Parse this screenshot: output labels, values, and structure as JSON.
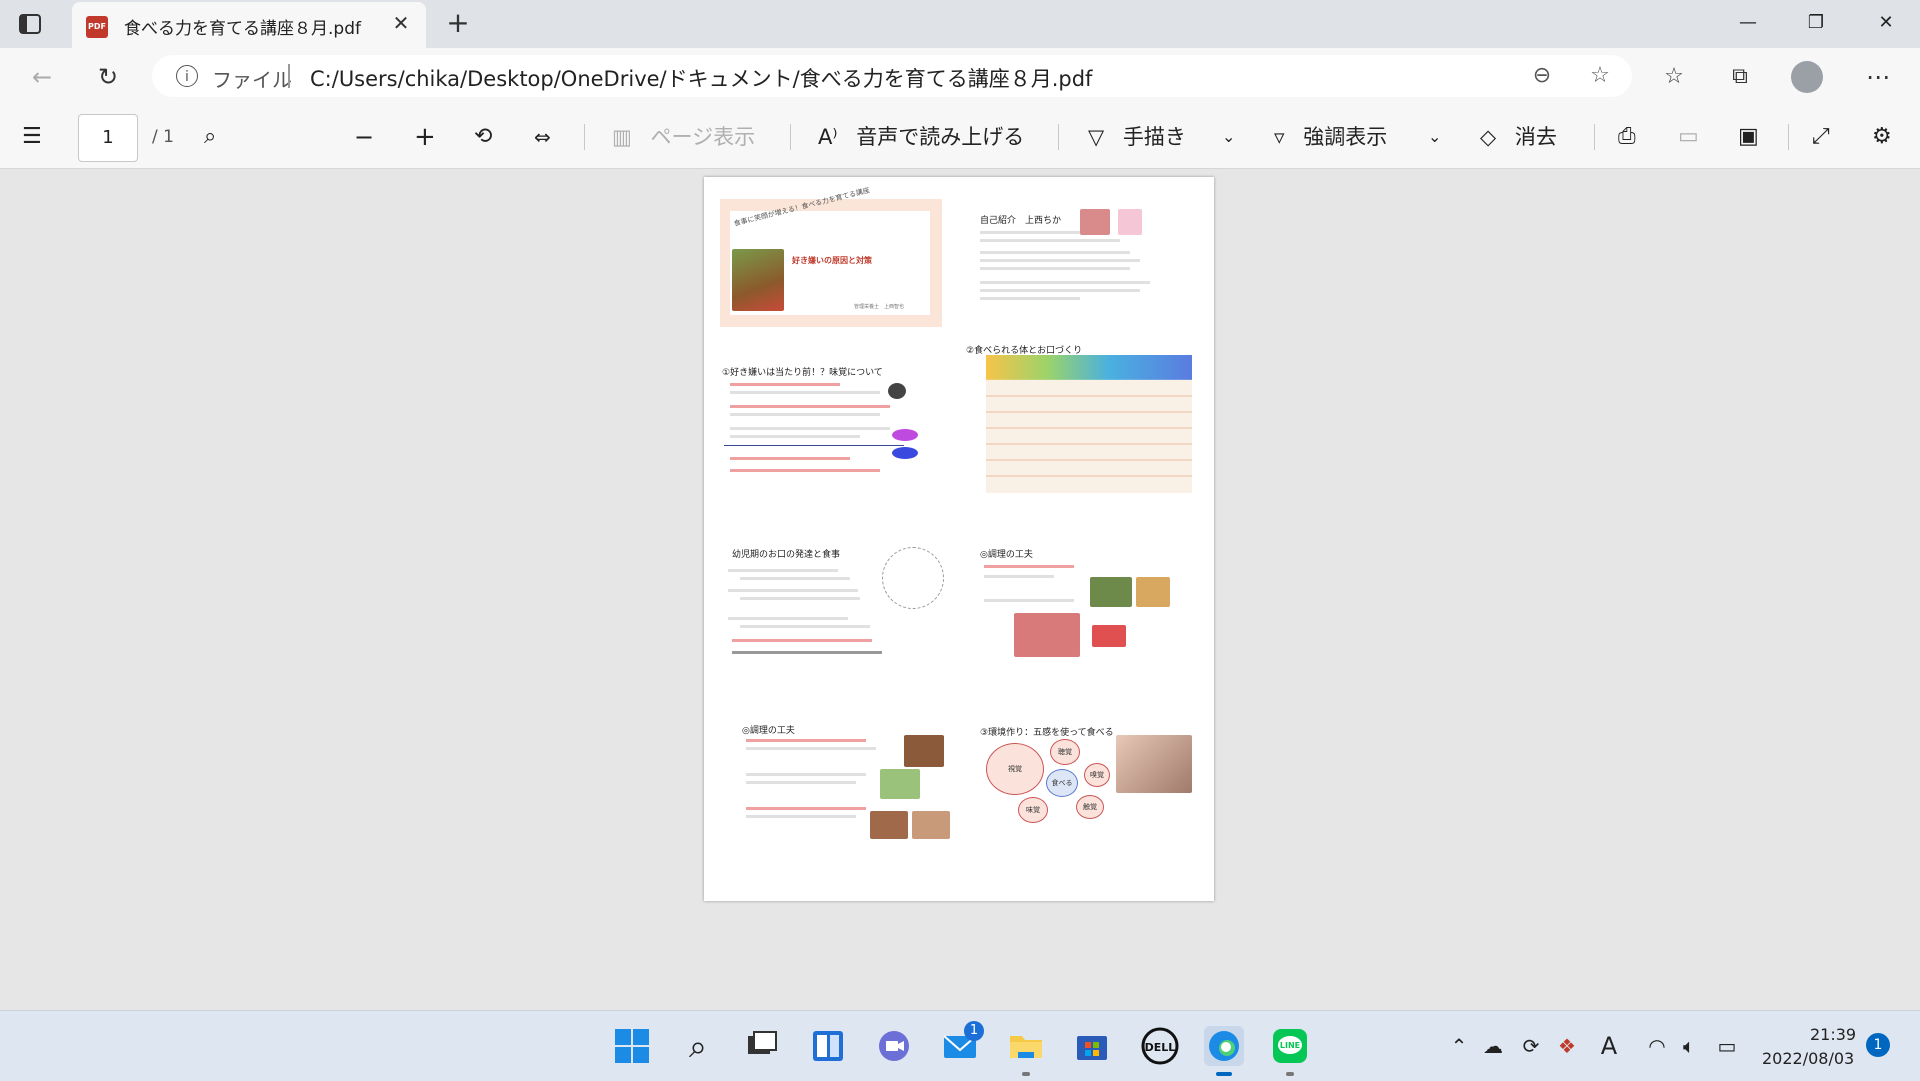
{
  "tab": {
    "title": "食べる力を育てる講座８月.pdf",
    "favicon": "pdf-icon"
  },
  "address": {
    "label": "ファイル",
    "url": "C:/Users/chika/Desktop/OneDrive/ドキュメント/食べる力を育てる講座８月.pdf"
  },
  "pdf_toolbar": {
    "page_current": "1",
    "page_total": "/ 1",
    "page_view": "ページ表示",
    "read_aloud": "音声で読み上げる",
    "draw": "手描き",
    "highlight": "強調表示",
    "erase": "消去"
  },
  "document": {
    "slides": [
      {
        "title": "好き嫌いの原因と対策",
        "subtitle": "食事に笑顔が増える！食べる力を育てる講座",
        "author": "管理栄養士　上西智也"
      },
      {
        "title": "自己紹介　上西ちか"
      },
      {
        "title": "①好き嫌いは当たり前！？味覚について"
      },
      {
        "title": "②食べられる体とお口づくり"
      },
      {
        "title": "幼児期のお口の発達と食事"
      },
      {
        "title": "◎調理の工夫"
      },
      {
        "title": "◎調理の工夫"
      },
      {
        "title": "③環境作り：五感を使って食べる"
      }
    ],
    "senses": [
      "視覚",
      "聴覚",
      "食べる",
      "嗅覚",
      "味覚",
      "触覚"
    ]
  },
  "taskbar": {
    "mail_badge": "1",
    "time": "21:39",
    "date": "2022/08/03",
    "notifications": "1",
    "ime": "A"
  }
}
